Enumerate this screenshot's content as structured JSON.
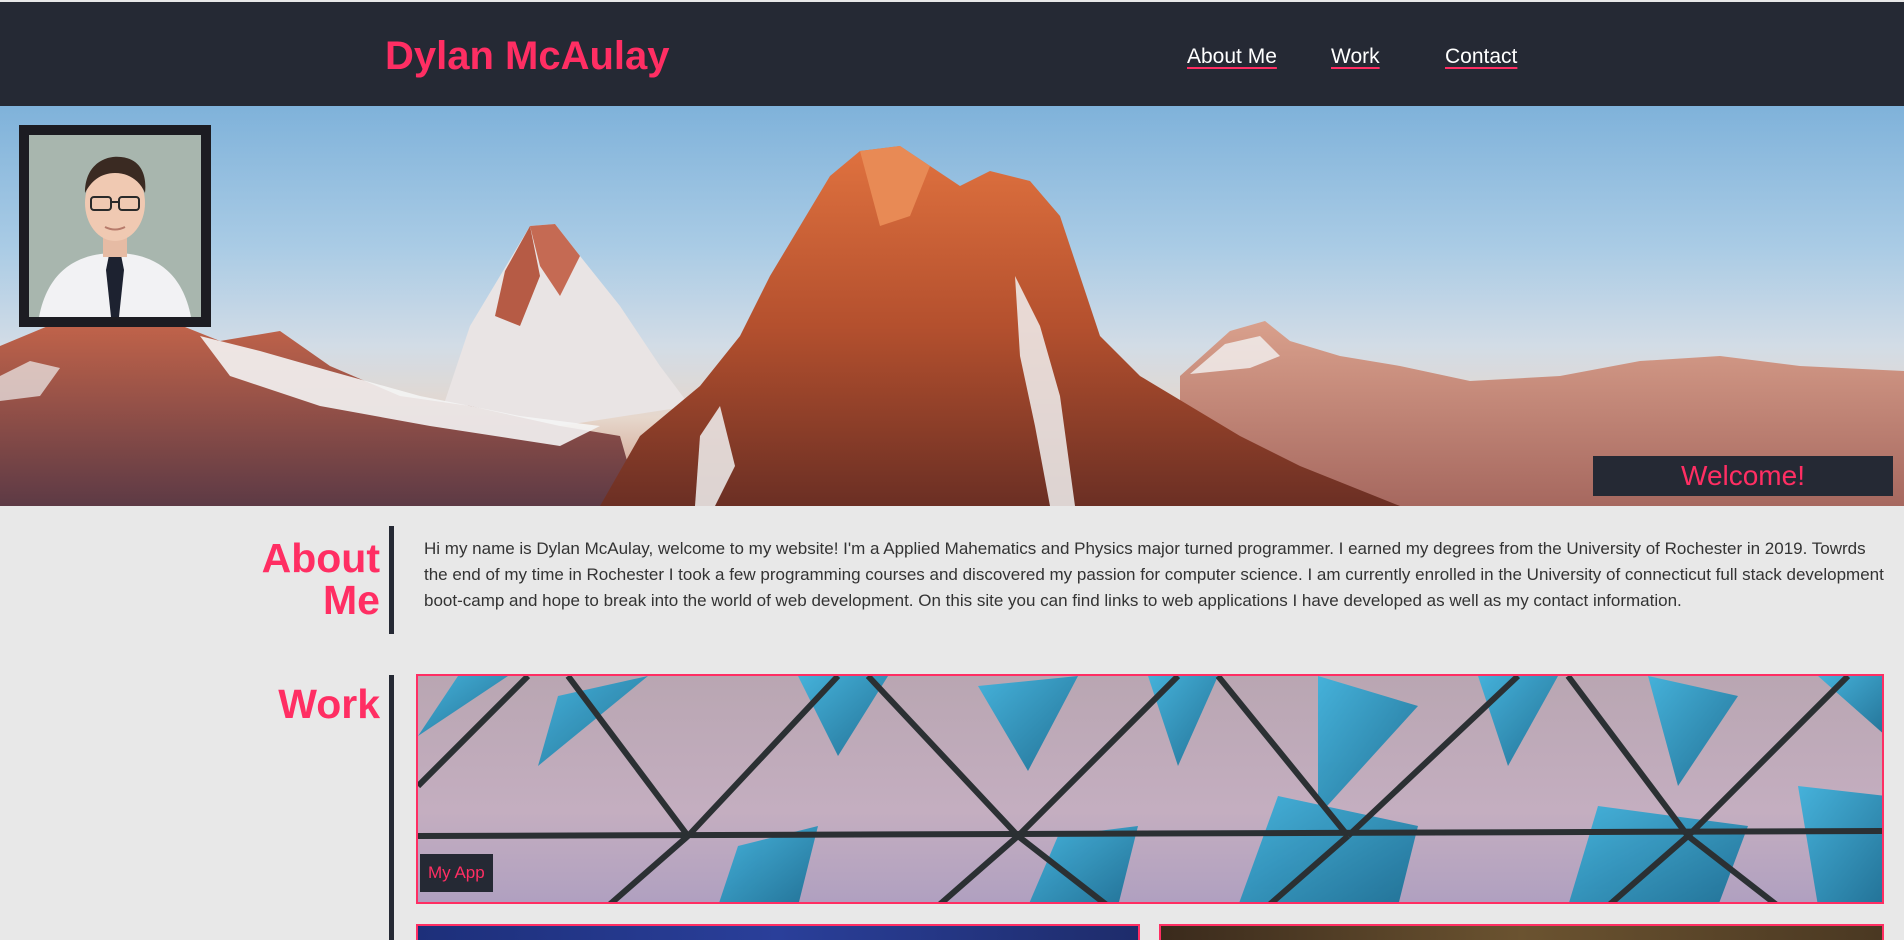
{
  "header": {
    "site_name": "Dylan McAulay",
    "nav": [
      {
        "label": "About Me"
      },
      {
        "label": "Work"
      },
      {
        "label": "Contact"
      }
    ]
  },
  "hero": {
    "welcome": "Welcome!"
  },
  "about": {
    "title": "About Me",
    "text": "Hi my name is Dylan McAulay, welcome to my website! I'm a Applied Mahematics and Physics major turned programmer. I earned my degrees from the University of Rochester in 2019. Towrds the end of my time in Rochester I took a few programming courses and discovered my passion for computer science. I am currently enrolled in the University of connecticut full stack development boot-camp and hope to break into the world of web development. On this site you can find links to web applications I have developed as well as my contact information."
  },
  "work": {
    "title": "Work",
    "cards": [
      {
        "label": "My App"
      }
    ]
  },
  "colors": {
    "accent": "#ff2e63",
    "dark": "#252934",
    "background": "#e8e8e8"
  }
}
